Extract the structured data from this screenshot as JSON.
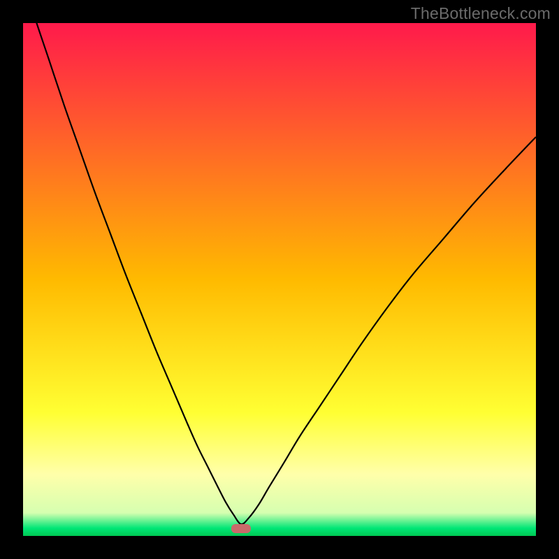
{
  "watermark": "TheBottleneck.com",
  "chart_data": {
    "type": "line",
    "title": "",
    "xlabel": "",
    "ylabel": "",
    "xlim": [
      0,
      100
    ],
    "ylim": [
      0,
      100
    ],
    "grid": false,
    "legend": false,
    "background_gradient": {
      "stops": [
        {
          "offset": 0.0,
          "color": "#ff1a4b"
        },
        {
          "offset": 0.5,
          "color": "#ffba00"
        },
        {
          "offset": 0.76,
          "color": "#ffff33"
        },
        {
          "offset": 0.88,
          "color": "#ffffaa"
        },
        {
          "offset": 0.955,
          "color": "#d6ffb0"
        },
        {
          "offset": 0.985,
          "color": "#00e676"
        },
        {
          "offset": 1.0,
          "color": "#00c853"
        }
      ]
    },
    "minimum_marker": {
      "x": 42.5,
      "y": 1.5,
      "color": "#c96a6a"
    },
    "series": [
      {
        "name": "curve",
        "x": [
          0,
          2,
          5,
          8,
          11,
          14,
          17,
          20,
          23,
          26,
          29,
          32,
          34,
          36,
          38,
          39.5,
          41,
          42.5,
          44,
          46,
          48,
          51,
          54,
          58,
          62,
          66,
          71,
          76,
          82,
          88,
          94,
          100
        ],
        "y": [
          109,
          102,
          93,
          84,
          75.5,
          67,
          59,
          51,
          43.5,
          36,
          29,
          22,
          17.5,
          13.5,
          9.5,
          6.6,
          4.2,
          2.3,
          3.5,
          6.2,
          9.6,
          14.5,
          19.5,
          25.5,
          31.5,
          37.5,
          44.5,
          51,
          58,
          65,
          71.5,
          77.8
        ]
      }
    ]
  }
}
